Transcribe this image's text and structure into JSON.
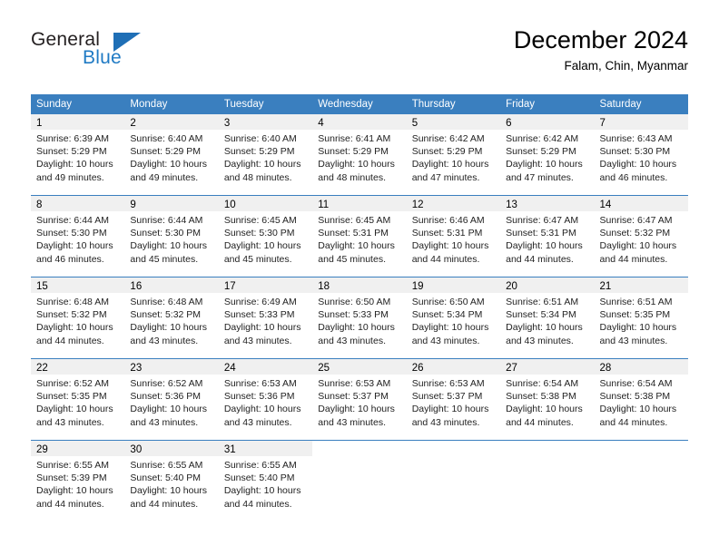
{
  "logo": {
    "primary_text": "General",
    "secondary_text": "Blue",
    "primary_color": "#231f20",
    "secondary_color": "#1f7ac4",
    "triangle_color": "#1f6fb6"
  },
  "header": {
    "title": "December 2024",
    "subtitle": "Falam, Chin, Myanmar"
  },
  "theme": {
    "header_bg": "#3a7fbf",
    "header_text": "#ffffff",
    "daynum_band_bg": "#f0f0f0",
    "row_divider": "#3a7fbf",
    "body_text": "#222222"
  },
  "weekdays": [
    "Sunday",
    "Monday",
    "Tuesday",
    "Wednesday",
    "Thursday",
    "Friday",
    "Saturday"
  ],
  "weeks": [
    [
      {
        "day": "1",
        "sunrise": "Sunrise: 6:39 AM",
        "sunset": "Sunset: 5:29 PM",
        "daylight_line1": "Daylight: 10 hours",
        "daylight_line2": "and 49 minutes."
      },
      {
        "day": "2",
        "sunrise": "Sunrise: 6:40 AM",
        "sunset": "Sunset: 5:29 PM",
        "daylight_line1": "Daylight: 10 hours",
        "daylight_line2": "and 49 minutes."
      },
      {
        "day": "3",
        "sunrise": "Sunrise: 6:40 AM",
        "sunset": "Sunset: 5:29 PM",
        "daylight_line1": "Daylight: 10 hours",
        "daylight_line2": "and 48 minutes."
      },
      {
        "day": "4",
        "sunrise": "Sunrise: 6:41 AM",
        "sunset": "Sunset: 5:29 PM",
        "daylight_line1": "Daylight: 10 hours",
        "daylight_line2": "and 48 minutes."
      },
      {
        "day": "5",
        "sunrise": "Sunrise: 6:42 AM",
        "sunset": "Sunset: 5:29 PM",
        "daylight_line1": "Daylight: 10 hours",
        "daylight_line2": "and 47 minutes."
      },
      {
        "day": "6",
        "sunrise": "Sunrise: 6:42 AM",
        "sunset": "Sunset: 5:29 PM",
        "daylight_line1": "Daylight: 10 hours",
        "daylight_line2": "and 47 minutes."
      },
      {
        "day": "7",
        "sunrise": "Sunrise: 6:43 AM",
        "sunset": "Sunset: 5:30 PM",
        "daylight_line1": "Daylight: 10 hours",
        "daylight_line2": "and 46 minutes."
      }
    ],
    [
      {
        "day": "8",
        "sunrise": "Sunrise: 6:44 AM",
        "sunset": "Sunset: 5:30 PM",
        "daylight_line1": "Daylight: 10 hours",
        "daylight_line2": "and 46 minutes."
      },
      {
        "day": "9",
        "sunrise": "Sunrise: 6:44 AM",
        "sunset": "Sunset: 5:30 PM",
        "daylight_line1": "Daylight: 10 hours",
        "daylight_line2": "and 45 minutes."
      },
      {
        "day": "10",
        "sunrise": "Sunrise: 6:45 AM",
        "sunset": "Sunset: 5:30 PM",
        "daylight_line1": "Daylight: 10 hours",
        "daylight_line2": "and 45 minutes."
      },
      {
        "day": "11",
        "sunrise": "Sunrise: 6:45 AM",
        "sunset": "Sunset: 5:31 PM",
        "daylight_line1": "Daylight: 10 hours",
        "daylight_line2": "and 45 minutes."
      },
      {
        "day": "12",
        "sunrise": "Sunrise: 6:46 AM",
        "sunset": "Sunset: 5:31 PM",
        "daylight_line1": "Daylight: 10 hours",
        "daylight_line2": "and 44 minutes."
      },
      {
        "day": "13",
        "sunrise": "Sunrise: 6:47 AM",
        "sunset": "Sunset: 5:31 PM",
        "daylight_line1": "Daylight: 10 hours",
        "daylight_line2": "and 44 minutes."
      },
      {
        "day": "14",
        "sunrise": "Sunrise: 6:47 AM",
        "sunset": "Sunset: 5:32 PM",
        "daylight_line1": "Daylight: 10 hours",
        "daylight_line2": "and 44 minutes."
      }
    ],
    [
      {
        "day": "15",
        "sunrise": "Sunrise: 6:48 AM",
        "sunset": "Sunset: 5:32 PM",
        "daylight_line1": "Daylight: 10 hours",
        "daylight_line2": "and 44 minutes."
      },
      {
        "day": "16",
        "sunrise": "Sunrise: 6:48 AM",
        "sunset": "Sunset: 5:32 PM",
        "daylight_line1": "Daylight: 10 hours",
        "daylight_line2": "and 43 minutes."
      },
      {
        "day": "17",
        "sunrise": "Sunrise: 6:49 AM",
        "sunset": "Sunset: 5:33 PM",
        "daylight_line1": "Daylight: 10 hours",
        "daylight_line2": "and 43 minutes."
      },
      {
        "day": "18",
        "sunrise": "Sunrise: 6:50 AM",
        "sunset": "Sunset: 5:33 PM",
        "daylight_line1": "Daylight: 10 hours",
        "daylight_line2": "and 43 minutes."
      },
      {
        "day": "19",
        "sunrise": "Sunrise: 6:50 AM",
        "sunset": "Sunset: 5:34 PM",
        "daylight_line1": "Daylight: 10 hours",
        "daylight_line2": "and 43 minutes."
      },
      {
        "day": "20",
        "sunrise": "Sunrise: 6:51 AM",
        "sunset": "Sunset: 5:34 PM",
        "daylight_line1": "Daylight: 10 hours",
        "daylight_line2": "and 43 minutes."
      },
      {
        "day": "21",
        "sunrise": "Sunrise: 6:51 AM",
        "sunset": "Sunset: 5:35 PM",
        "daylight_line1": "Daylight: 10 hours",
        "daylight_line2": "and 43 minutes."
      }
    ],
    [
      {
        "day": "22",
        "sunrise": "Sunrise: 6:52 AM",
        "sunset": "Sunset: 5:35 PM",
        "daylight_line1": "Daylight: 10 hours",
        "daylight_line2": "and 43 minutes."
      },
      {
        "day": "23",
        "sunrise": "Sunrise: 6:52 AM",
        "sunset": "Sunset: 5:36 PM",
        "daylight_line1": "Daylight: 10 hours",
        "daylight_line2": "and 43 minutes."
      },
      {
        "day": "24",
        "sunrise": "Sunrise: 6:53 AM",
        "sunset": "Sunset: 5:36 PM",
        "daylight_line1": "Daylight: 10 hours",
        "daylight_line2": "and 43 minutes."
      },
      {
        "day": "25",
        "sunrise": "Sunrise: 6:53 AM",
        "sunset": "Sunset: 5:37 PM",
        "daylight_line1": "Daylight: 10 hours",
        "daylight_line2": "and 43 minutes."
      },
      {
        "day": "26",
        "sunrise": "Sunrise: 6:53 AM",
        "sunset": "Sunset: 5:37 PM",
        "daylight_line1": "Daylight: 10 hours",
        "daylight_line2": "and 43 minutes."
      },
      {
        "day": "27",
        "sunrise": "Sunrise: 6:54 AM",
        "sunset": "Sunset: 5:38 PM",
        "daylight_line1": "Daylight: 10 hours",
        "daylight_line2": "and 44 minutes."
      },
      {
        "day": "28",
        "sunrise": "Sunrise: 6:54 AM",
        "sunset": "Sunset: 5:38 PM",
        "daylight_line1": "Daylight: 10 hours",
        "daylight_line2": "and 44 minutes."
      }
    ],
    [
      {
        "day": "29",
        "sunrise": "Sunrise: 6:55 AM",
        "sunset": "Sunset: 5:39 PM",
        "daylight_line1": "Daylight: 10 hours",
        "daylight_line2": "and 44 minutes."
      },
      {
        "day": "30",
        "sunrise": "Sunrise: 6:55 AM",
        "sunset": "Sunset: 5:40 PM",
        "daylight_line1": "Daylight: 10 hours",
        "daylight_line2": "and 44 minutes."
      },
      {
        "day": "31",
        "sunrise": "Sunrise: 6:55 AM",
        "sunset": "Sunset: 5:40 PM",
        "daylight_line1": "Daylight: 10 hours",
        "daylight_line2": "and 44 minutes."
      },
      {
        "day": "",
        "sunrise": "",
        "sunset": "",
        "daylight_line1": "",
        "daylight_line2": ""
      },
      {
        "day": "",
        "sunrise": "",
        "sunset": "",
        "daylight_line1": "",
        "daylight_line2": ""
      },
      {
        "day": "",
        "sunrise": "",
        "sunset": "",
        "daylight_line1": "",
        "daylight_line2": ""
      },
      {
        "day": "",
        "sunrise": "",
        "sunset": "",
        "daylight_line1": "",
        "daylight_line2": ""
      }
    ]
  ]
}
